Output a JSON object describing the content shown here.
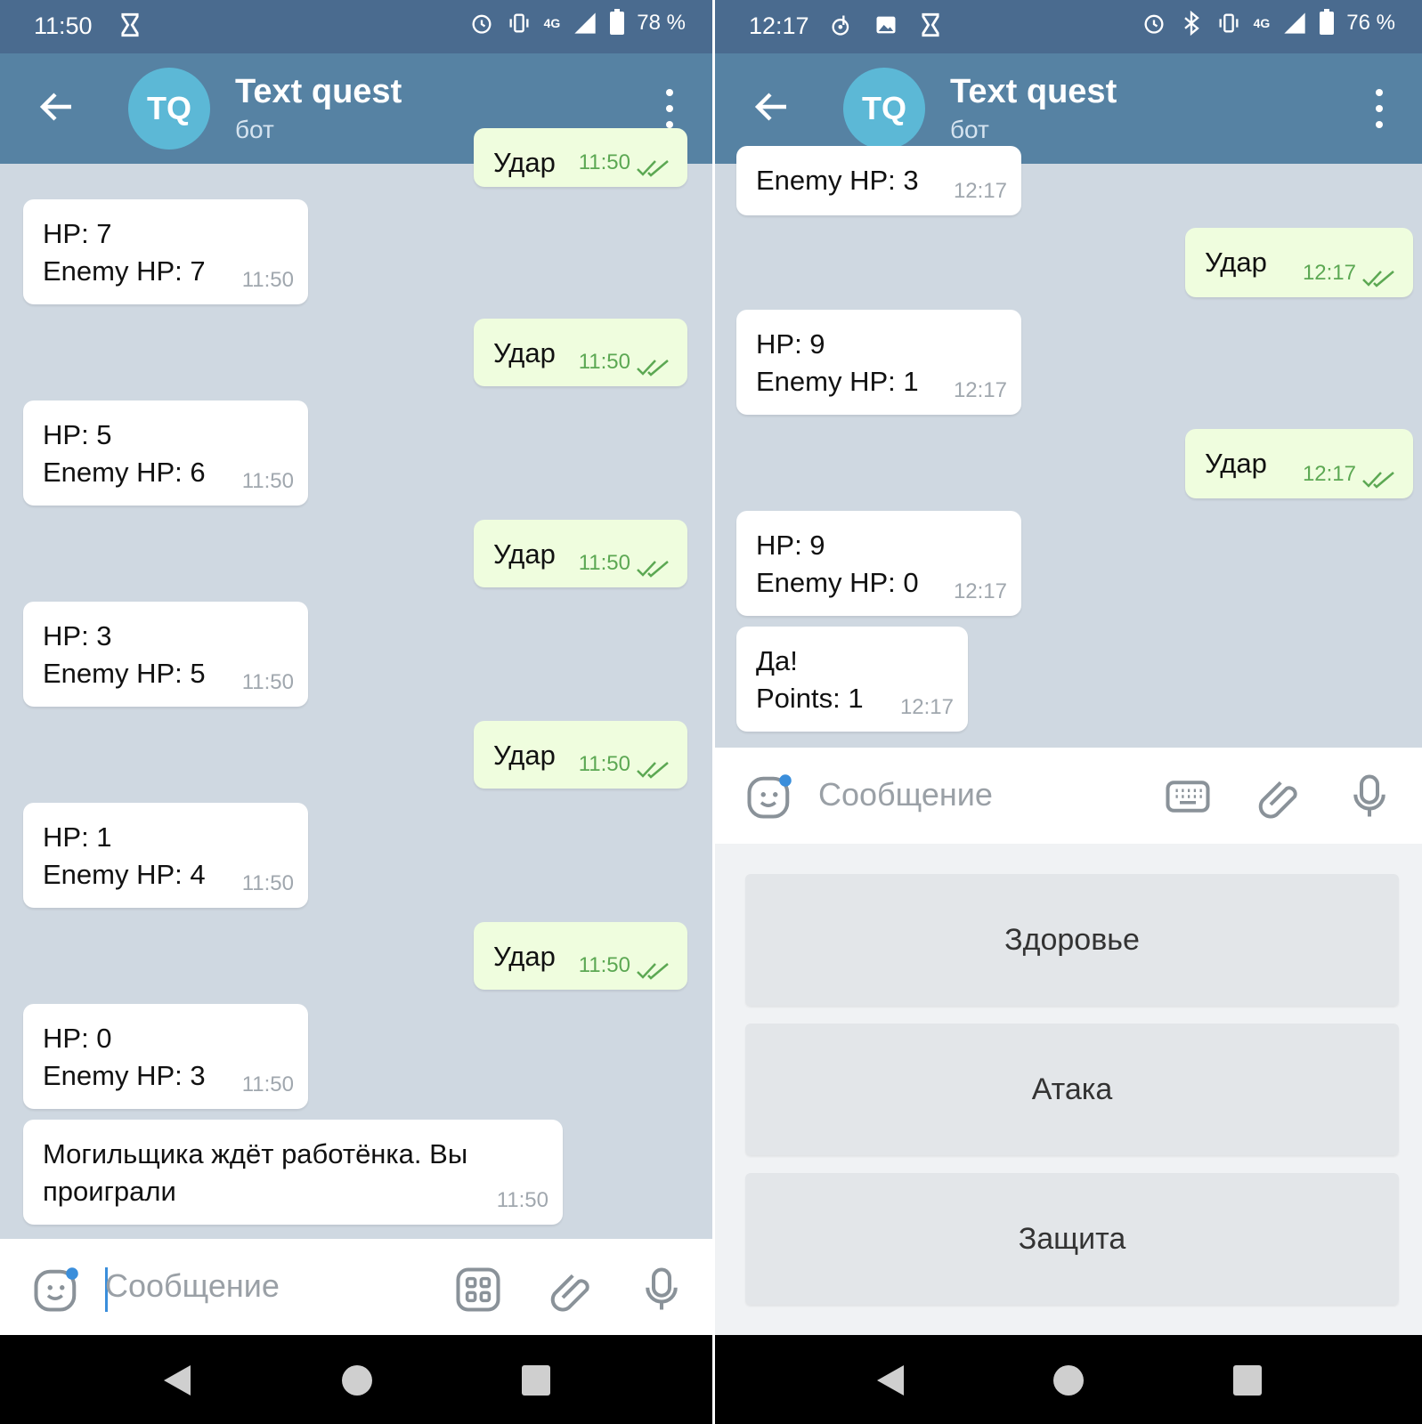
{
  "left": {
    "status": {
      "time": "11:50",
      "network": "4G",
      "battery": "78 %"
    },
    "header": {
      "avatar": "TQ",
      "title": "Text quest",
      "subtitle": "бот"
    },
    "partial_out": {
      "text": "Удар",
      "time": "11:50"
    },
    "messages": [
      {
        "dir": "in",
        "text": "HP: 7\nEnemy HP: 7",
        "time": "11:50"
      },
      {
        "dir": "out",
        "text": "Удар",
        "time": "11:50"
      },
      {
        "dir": "in",
        "text": "HP: 5\nEnemy HP: 6",
        "time": "11:50"
      },
      {
        "dir": "out",
        "text": "Удар",
        "time": "11:50"
      },
      {
        "dir": "in",
        "text": "HP: 3\nEnemy HP: 5",
        "time": "11:50"
      },
      {
        "dir": "out",
        "text": "Удар",
        "time": "11:50"
      },
      {
        "dir": "in",
        "text": "HP: 1\nEnemy HP: 4",
        "time": "11:50"
      },
      {
        "dir": "out",
        "text": "Удар",
        "time": "11:50"
      },
      {
        "dir": "in",
        "text": "HP: 0\nEnemy HP: 3",
        "time": "11:50"
      },
      {
        "dir": "in",
        "text": "Могильщика ждёт работёнка. Вы\nпроиграли",
        "time": "11:50"
      }
    ],
    "input": {
      "placeholder": "Сообщение"
    }
  },
  "right": {
    "status": {
      "time": "12:17",
      "network": "4G",
      "battery": "76 %"
    },
    "header": {
      "avatar": "TQ",
      "title": "Text quest",
      "subtitle": "бот"
    },
    "partial_in": {
      "text": "Enemy HP: 3",
      "time": "12:17"
    },
    "messages": [
      {
        "dir": "out",
        "text": "Удар",
        "time": "12:17"
      },
      {
        "dir": "in",
        "text": "HP: 9\nEnemy HP: 1",
        "time": "12:17"
      },
      {
        "dir": "out",
        "text": "Удар",
        "time": "12:17"
      },
      {
        "dir": "in",
        "text": "HP: 9\nEnemy HP: 0",
        "time": "12:17"
      },
      {
        "dir": "in",
        "text": "Да!\nPoints: 1",
        "time": "12:17"
      }
    ],
    "input": {
      "placeholder": "Сообщение"
    },
    "keyboard": [
      "Здоровье",
      "Атака",
      "Защита"
    ]
  },
  "colors": {
    "statusbar": "#4a6b8f",
    "header": "#5682a3",
    "avatar": "#5cb8d6",
    "chat_bg": "#cfd8e1",
    "bubble_in": "#ffffff",
    "bubble_out": "#effdde",
    "time_out": "#5ca853"
  },
  "icons": [
    "back-arrow-icon",
    "more-vertical-icon",
    "sticker-icon",
    "bot-commands-icon",
    "keyboard-icon",
    "attach-icon",
    "mic-icon",
    "alarm-icon",
    "vibrate-icon",
    "signal-icon",
    "battery-icon",
    "hourglass-icon",
    "bluetooth-icon",
    "image-icon",
    "music-icon",
    "double-check-icon"
  ]
}
